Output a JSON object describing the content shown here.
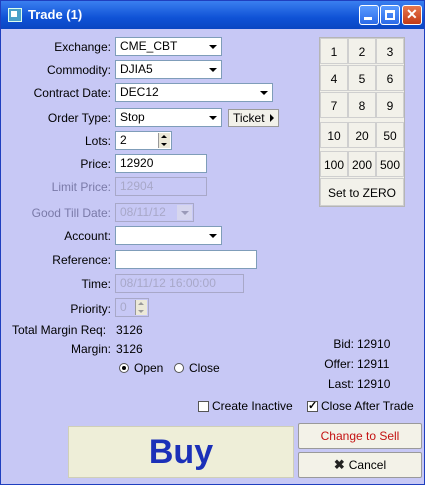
{
  "window": {
    "title": "Trade (1)"
  },
  "form": {
    "exchange": {
      "label": "Exchange:",
      "value": "CME_CBT"
    },
    "commodity": {
      "label": "Commodity:",
      "value": "DJIA5"
    },
    "contract_date": {
      "label": "Contract Date:",
      "value": "DEC12"
    },
    "order_type": {
      "label": "Order Type:",
      "value": "Stop"
    },
    "ticket_label": "Ticket",
    "lots": {
      "label": "Lots:",
      "value": "2"
    },
    "price": {
      "label": "Price:",
      "value": "12920"
    },
    "limit_price": {
      "label": "Limit Price:",
      "value": "12904"
    },
    "good_till_date": {
      "label": "Good Till Date:",
      "value": "08/11/12"
    },
    "account": {
      "label": "Account:",
      "value": ""
    },
    "reference": {
      "label": "Reference:",
      "value": ""
    },
    "time": {
      "label": "Time:",
      "value": "08/11/12 16:00:00"
    },
    "priority": {
      "label": "Priority:",
      "value": "0"
    }
  },
  "keypad": {
    "keys": [
      "1",
      "2",
      "3",
      "4",
      "5",
      "6",
      "7",
      "8",
      "9",
      "10",
      "20",
      "50",
      "100",
      "200",
      "500"
    ],
    "zero_label": "Set to ZERO"
  },
  "margin": {
    "total_label": "Total Margin Req:",
    "total_value": "3126",
    "margin_label": "Margin:",
    "margin_value": "3126"
  },
  "quote": {
    "bid_label": "Bid:",
    "bid_value": "12910",
    "offer_label": "Offer:",
    "offer_value": "12911",
    "last_label": "Last:",
    "last_value": "12910"
  },
  "position": {
    "open_label": "Open",
    "close_label": "Close",
    "selected": "Open"
  },
  "options": {
    "create_inactive_label": "Create Inactive",
    "create_inactive_checked": false,
    "close_after_trade_label": "Close After Trade",
    "close_after_trade_checked": true
  },
  "actions": {
    "buy_label": "Buy",
    "change_label": "Change to Sell",
    "cancel_label": "Cancel"
  },
  "colors": {
    "titlebar": "#0f52d6",
    "panel": "#c7c8f5",
    "buy_text": "#1b30b8",
    "sell_text": "#c41212"
  }
}
